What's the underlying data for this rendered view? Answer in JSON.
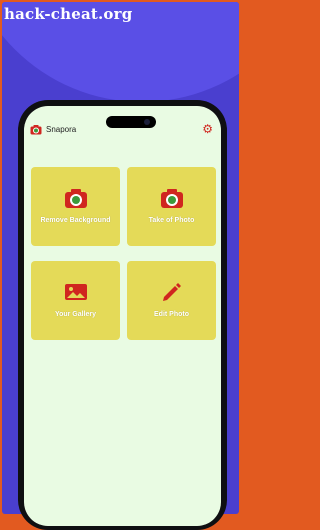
{
  "watermark": "hack-cheat.org",
  "app": {
    "title": "Snapora"
  },
  "actions": [
    {
      "label": "Remove Background",
      "icon": "camera-icon"
    },
    {
      "label": "Take of Photo",
      "icon": "camera-icon"
    },
    {
      "label": "Your Gallery",
      "icon": "gallery-icon"
    },
    {
      "label": "Edit Photo",
      "icon": "pencil-icon"
    }
  ],
  "colors": {
    "background": "#4a3fcf",
    "card": "#e4da58",
    "screen": "#e9fbe3",
    "accent": "#d0261f"
  }
}
